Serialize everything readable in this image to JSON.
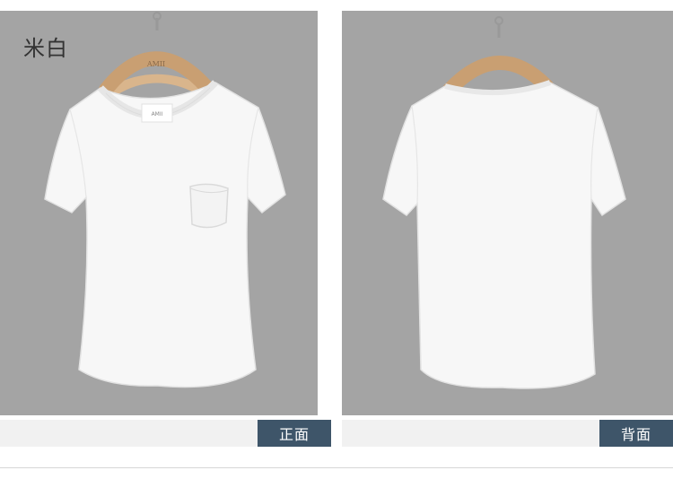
{
  "color_name": "米白",
  "front": {
    "caption": "正面",
    "hanger_brand": "AMII",
    "tag_brand": "AMII"
  },
  "back": {
    "caption": "背面"
  },
  "colors": {
    "panel_bg": "#a4a4a4",
    "caption_tag_bg": "#3e5569",
    "caption_bar_bg": "#f1f1f1",
    "shirt": "#f7f7f7"
  }
}
